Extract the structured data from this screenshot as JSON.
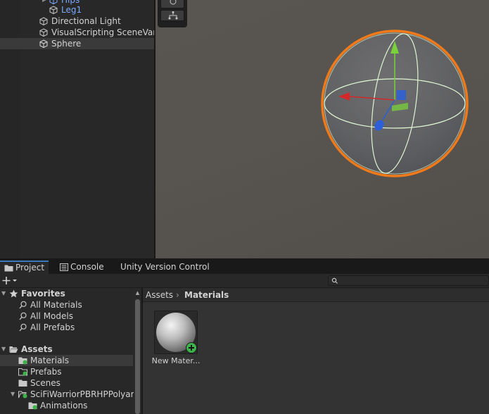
{
  "hierarchy": {
    "items": [
      {
        "label": "Hips"
      },
      {
        "label": "Leg1"
      },
      {
        "label": "Directional Light"
      },
      {
        "label": "VisualScripting SceneVari"
      },
      {
        "label": "Sphere"
      }
    ]
  },
  "project": {
    "tabs": [
      {
        "label": "Project"
      },
      {
        "label": "Console"
      },
      {
        "label": "Unity Version Control"
      }
    ],
    "search": {
      "value": ""
    },
    "favorites": {
      "label": "Favorites",
      "items": [
        {
          "label": "All Materials"
        },
        {
          "label": "All Models"
        },
        {
          "label": "All Prefabs"
        }
      ]
    },
    "assets_tree": {
      "label": "Assets",
      "items": [
        {
          "label": "Materials"
        },
        {
          "label": "Prefabs"
        },
        {
          "label": "Scenes"
        },
        {
          "label": "SciFiWarriorPBRHPPolyar"
        },
        {
          "label": "Animations"
        }
      ]
    },
    "breadcrumb": [
      {
        "label": "Assets"
      },
      {
        "label": "Materials"
      }
    ],
    "breadcrumb_separator": "›",
    "assets": [
      {
        "label": "New Mater..."
      }
    ]
  },
  "colors": {
    "selection_outline": "#f07a1a",
    "tab_accent": "#3a79bb",
    "add_badge": "#3bb54a"
  }
}
